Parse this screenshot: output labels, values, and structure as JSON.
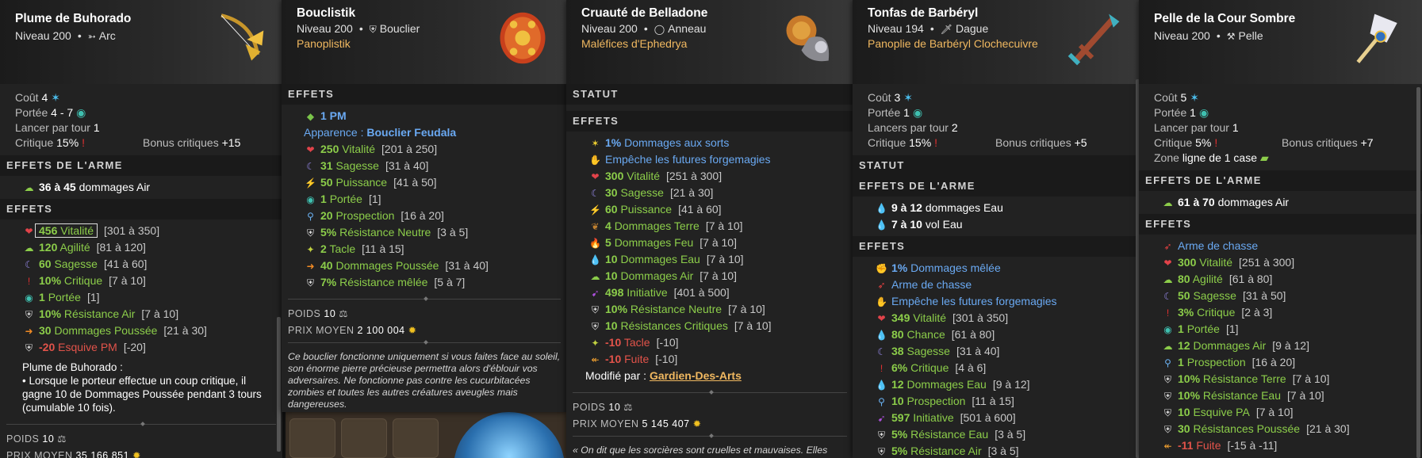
{
  "background": {
    "slots": 3
  },
  "panels": [
    {
      "name": "Plume de Buhorado",
      "level": "Niveau 200",
      "type": "Arc",
      "type_icon": "bow-icon",
      "info": {
        "cost_label": "Coût",
        "cost_value": "4",
        "range_label": "Portée",
        "range_value": "4 - 7",
        "casts_label": "Lancer par tour",
        "casts_value": "1",
        "crit_label": "Critique",
        "crit_value": "15%",
        "bonus_label": "Bonus critiques",
        "bonus_value": "+15"
      },
      "weapon_header": "Effets de l'arme",
      "weapon_effects": [
        {
          "icon": "air-icon",
          "val": "36 à 45",
          "text": "dommages Air"
        }
      ],
      "effects_header": "Effets",
      "effects": [
        {
          "icon": "heart-icon",
          "val": "456",
          "text": "Vitalité",
          "range": "[301 à 350]",
          "color": "grn",
          "hl": true
        },
        {
          "icon": "air-icon",
          "val": "120",
          "text": "Agilité",
          "range": "[81 à 120]",
          "color": "grn"
        },
        {
          "icon": "moon-icon",
          "val": "60",
          "text": "Sagesse",
          "range": "[41 à 60]",
          "color": "grn"
        },
        {
          "icon": "exclaim-icon",
          "val": "10%",
          "text": "Critique",
          "range": "[7 à 10]",
          "color": "grn"
        },
        {
          "icon": "eye-icon",
          "val": "1",
          "text": "Portée",
          "range": "[1]",
          "color": "grn"
        },
        {
          "icon": "shield-icon",
          "val": "10%",
          "text": "Résistance Air",
          "range": "[7 à 10]",
          "color": "grn"
        },
        {
          "icon": "arrow-icon",
          "val": "30",
          "text": "Dommages Poussée",
          "range": "[21 à 30]",
          "color": "grn"
        },
        {
          "icon": "shield-icon",
          "val": "-20",
          "text": "Esquive PM",
          "range": "[-20]",
          "color": "red"
        }
      ],
      "desc": "Plume de Buhorado :\n• Lorsque le porteur effectue un coup critique, il gagne 10 de Dommages Poussée pendant 3 tours (cumulable 10 fois).",
      "weight_label": "POIDS",
      "weight": "10",
      "price_label": "PRIX MOYEN",
      "price": "35 166 851"
    },
    {
      "name": "Bouclistik",
      "level": "Niveau 200",
      "type": "Bouclier",
      "type_icon": "shield-icon",
      "set": "Panoplistik",
      "effects_header": "Effets",
      "effects": [
        {
          "icon": "pm-icon",
          "val": "1 PM",
          "text": "",
          "range": "",
          "color": "blu"
        },
        {
          "icon": "",
          "val": "",
          "text": "Apparence : ",
          "range": "",
          "color": "blu",
          "extra": "Bouclier Feudala"
        },
        {
          "icon": "heart-icon",
          "val": "250",
          "text": "Vitalité",
          "range": "[201 à 250]",
          "color": "grn"
        },
        {
          "icon": "moon-icon",
          "val": "31",
          "text": "Sagesse",
          "range": "[31 à 40]",
          "color": "grn"
        },
        {
          "icon": "bolt-icon",
          "val": "50",
          "text": "Puissance",
          "range": "[41 à 50]",
          "color": "grn"
        },
        {
          "icon": "eye-icon",
          "val": "1",
          "text": "Portée",
          "range": "[1]",
          "color": "grn"
        },
        {
          "icon": "search-icon",
          "val": "20",
          "text": "Prospection",
          "range": "[16 à 20]",
          "color": "grn"
        },
        {
          "icon": "shield-icon",
          "val": "5%",
          "text": "Résistance Neutre",
          "range": "[3 à 5]",
          "color": "grn"
        },
        {
          "icon": "tackle-icon",
          "val": "2",
          "text": "Tacle",
          "range": "[11 à 15]",
          "color": "grn"
        },
        {
          "icon": "arrow-icon",
          "val": "40",
          "text": "Dommages Poussée",
          "range": "[31 à 40]",
          "color": "grn"
        },
        {
          "icon": "shield-icon",
          "val": "7%",
          "text": "Résistance mêlée",
          "range": "[5 à 7]",
          "color": "grn"
        }
      ],
      "weight_label": "POIDS",
      "weight": "10",
      "price_label": "PRIX MOYEN",
      "price": "2 100 004",
      "italic": "Ce bouclier fonctionne uniquement si vous faites face au soleil, son énorme pierre précieuse permettra alors d'éblouir vos adversaires. Ne fonctionne pas contre les cucurbitacées zombies et toutes les autres créatures aveugles mais dangereuses."
    },
    {
      "name": "Cruauté de Belladone",
      "level": "Niveau 200",
      "type": "Anneau",
      "type_icon": "ring-icon",
      "set": "Maléfices d'Ephedrya",
      "statut_header": "Statut",
      "effects_header": "Effets",
      "effects": [
        {
          "icon": "star-icon",
          "val": "1%",
          "text": "Dommages aux sorts",
          "range": "",
          "color": "blu"
        },
        {
          "icon": "hand-icon",
          "val": "",
          "text": "Empêche les futures forgemagies",
          "range": "",
          "color": "blu"
        },
        {
          "icon": "heart-icon",
          "val": "300",
          "text": "Vitalité",
          "range": "[251 à 300]",
          "color": "grn"
        },
        {
          "icon": "moon-icon",
          "val": "30",
          "text": "Sagesse",
          "range": "[21 à 30]",
          "color": "grn"
        },
        {
          "icon": "bolt-icon",
          "val": "60",
          "text": "Puissance",
          "range": "[41 à 60]",
          "color": "grn"
        },
        {
          "icon": "earth-icon",
          "val": "4",
          "text": "Dommages Terre",
          "range": "[7 à 10]",
          "color": "grn"
        },
        {
          "icon": "fire-icon",
          "val": "5",
          "text": "Dommages Feu",
          "range": "[7 à 10]",
          "color": "grn"
        },
        {
          "icon": "water-icon",
          "val": "10",
          "text": "Dommages Eau",
          "range": "[7 à 10]",
          "color": "grn"
        },
        {
          "icon": "air-icon",
          "val": "10",
          "text": "Dommages Air",
          "range": "[7 à 10]",
          "color": "grn"
        },
        {
          "icon": "init-icon",
          "val": "498",
          "text": "Initiative",
          "range": "[401 à 500]",
          "color": "grn"
        },
        {
          "icon": "shield-icon",
          "val": "10%",
          "text": "Résistance Neutre",
          "range": "[7 à 10]",
          "color": "grn"
        },
        {
          "icon": "shield-icon",
          "val": "10",
          "text": "Résistances Critiques",
          "range": "[7 à 10]",
          "color": "grn"
        },
        {
          "icon": "tackle-icon",
          "val": "-10",
          "text": "Tacle",
          "range": "[-10]",
          "color": "red"
        },
        {
          "icon": "flee-icon",
          "val": "-10",
          "text": "Fuite",
          "range": "[-10]",
          "color": "red"
        }
      ],
      "modified_label": "Modifié par :",
      "modified_by": "Gardien-Des-Arts",
      "weight_label": "POIDS",
      "weight": "10",
      "price_label": "PRIX MOYEN",
      "price": "5 145 407",
      "italic": "« On dit que les sorcières sont cruelles et mauvaises. Elles"
    },
    {
      "name": "Tonfas de Barbéryl",
      "level": "Niveau 194",
      "type": "Dague",
      "type_icon": "dagger-icon",
      "set": "Panoplie de Barbéryl Clochecuivre",
      "info": {
        "cost_label": "Coût",
        "cost_value": "3",
        "range_label": "Portée",
        "range_value": "1",
        "casts_label": "Lancers par tour",
        "casts_value": "2",
        "crit_label": "Critique",
        "crit_value": "15%",
        "bonus_label": "Bonus critiques",
        "bonus_value": "+5"
      },
      "statut_header": "Statut",
      "weapon_header": "Effets de l'arme",
      "weapon_effects": [
        {
          "icon": "water-icon",
          "val": "9 à 12",
          "text": "dommages Eau"
        },
        {
          "icon": "water-icon",
          "val": "7 à 10",
          "text": "vol Eau"
        }
      ],
      "effects_header": "Effets",
      "effects": [
        {
          "icon": "melee-icon",
          "val": "1%",
          "text": "Dommages mêlée",
          "range": "",
          "color": "blu"
        },
        {
          "icon": "feather-icon",
          "val": "",
          "text": "Arme de chasse",
          "range": "",
          "color": "blu"
        },
        {
          "icon": "hand-icon",
          "val": "",
          "text": "Empêche les futures forgemagies",
          "range": "",
          "color": "blu"
        },
        {
          "icon": "heart-icon",
          "val": "349",
          "text": "Vitalité",
          "range": "[301 à 350]",
          "color": "grn"
        },
        {
          "icon": "water-icon",
          "val": "80",
          "text": "Chance",
          "range": "[61 à 80]",
          "color": "grn"
        },
        {
          "icon": "moon-icon",
          "val": "38",
          "text": "Sagesse",
          "range": "[31 à 40]",
          "color": "grn"
        },
        {
          "icon": "exclaim-icon",
          "val": "6%",
          "text": "Critique",
          "range": "[4 à 6]",
          "color": "grn"
        },
        {
          "icon": "water-icon",
          "val": "12",
          "text": "Dommages Eau",
          "range": "[9 à 12]",
          "color": "grn"
        },
        {
          "icon": "search-icon",
          "val": "10",
          "text": "Prospection",
          "range": "[11 à 15]",
          "color": "grn"
        },
        {
          "icon": "init-icon",
          "val": "597",
          "text": "Initiative",
          "range": "[501 à 600]",
          "color": "grn"
        },
        {
          "icon": "shield-icon",
          "val": "5%",
          "text": "Résistance Eau",
          "range": "[3 à 5]",
          "color": "grn"
        },
        {
          "icon": "shield-icon",
          "val": "5%",
          "text": "Résistance Air",
          "range": "[3 à 5]",
          "color": "grn"
        }
      ]
    },
    {
      "name": "Pelle de la Cour Sombre",
      "level": "Niveau 200",
      "type": "Pelle",
      "type_icon": "shovel-icon",
      "info": {
        "cost_label": "Coût",
        "cost_value": "5",
        "range_label": "Portée",
        "range_value": "1",
        "casts_label": "Lancer par tour",
        "casts_value": "1",
        "crit_label": "Critique",
        "crit_value": "5%",
        "bonus_label": "Bonus critiques",
        "bonus_value": "+7",
        "zone_label": "Zone",
        "zone_value": "ligne de 1 case"
      },
      "weapon_header": "Effets de l'arme",
      "weapon_effects": [
        {
          "icon": "air-icon",
          "val": "61 à 70",
          "text": "dommages Air"
        }
      ],
      "effects_header": "Effets",
      "effects": [
        {
          "icon": "feather-icon",
          "val": "",
          "text": "Arme de chasse",
          "range": "",
          "color": "blu"
        },
        {
          "icon": "heart-icon",
          "val": "300",
          "text": "Vitalité",
          "range": "[251 à 300]",
          "color": "grn"
        },
        {
          "icon": "air-icon",
          "val": "80",
          "text": "Agilité",
          "range": "[61 à 80]",
          "color": "grn"
        },
        {
          "icon": "moon-icon",
          "val": "50",
          "text": "Sagesse",
          "range": "[31 à 50]",
          "color": "grn"
        },
        {
          "icon": "exclaim-icon",
          "val": "3%",
          "text": "Critique",
          "range": "[2 à 3]",
          "color": "grn"
        },
        {
          "icon": "eye-icon",
          "val": "1",
          "text": "Portée",
          "range": "[1]",
          "color": "grn"
        },
        {
          "icon": "air-icon",
          "val": "12",
          "text": "Dommages Air",
          "range": "[9 à 12]",
          "color": "grn"
        },
        {
          "icon": "search-icon",
          "val": "1",
          "text": "Prospection",
          "range": "[16 à 20]",
          "color": "grn"
        },
        {
          "icon": "shield-icon",
          "val": "10%",
          "text": "Résistance Terre",
          "range": "[7 à 10]",
          "color": "grn"
        },
        {
          "icon": "shield-icon",
          "val": "10%",
          "text": "Résistance Eau",
          "range": "[7 à 10]",
          "color": "grn"
        },
        {
          "icon": "shield-icon",
          "val": "10",
          "text": "Esquive PA",
          "range": "[7 à 10]",
          "color": "grn"
        },
        {
          "icon": "shield-icon",
          "val": "30",
          "text": "Résistances Poussée",
          "range": "[21 à 30]",
          "color": "grn"
        },
        {
          "icon": "flee-icon",
          "val": "-11",
          "text": "Fuite",
          "range": "[-15 à -11]",
          "color": "red"
        }
      ]
    }
  ]
}
